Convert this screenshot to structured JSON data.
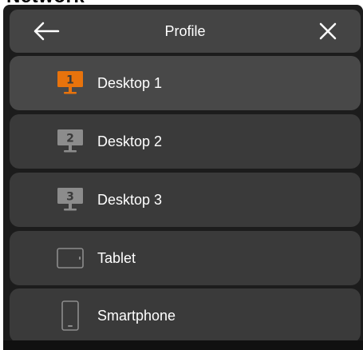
{
  "window": {
    "fragment_text": "Network"
  },
  "header": {
    "title": "Profile",
    "back_icon": "arrow-left-icon",
    "close_icon": "close-icon"
  },
  "profiles": [
    {
      "label": "Desktop 1",
      "icon": "monitor-icon",
      "badge": "1",
      "selected": true
    },
    {
      "label": "Desktop 2",
      "icon": "monitor-icon",
      "badge": "2",
      "selected": false
    },
    {
      "label": "Desktop 3",
      "icon": "monitor-icon",
      "badge": "3",
      "selected": false
    },
    {
      "label": "Tablet",
      "icon": "tablet-icon",
      "badge": "",
      "selected": false
    },
    {
      "label": "Smartphone",
      "icon": "smartphone-icon",
      "badge": "",
      "selected": false
    }
  ],
  "colors": {
    "accent": "#e8730c",
    "inactive_icon": "#8c8c8c",
    "panel_bg": "#1c1c1c",
    "row_bg": "#3a3a3a",
    "header_bg": "#444444",
    "text": "#ffffff"
  }
}
